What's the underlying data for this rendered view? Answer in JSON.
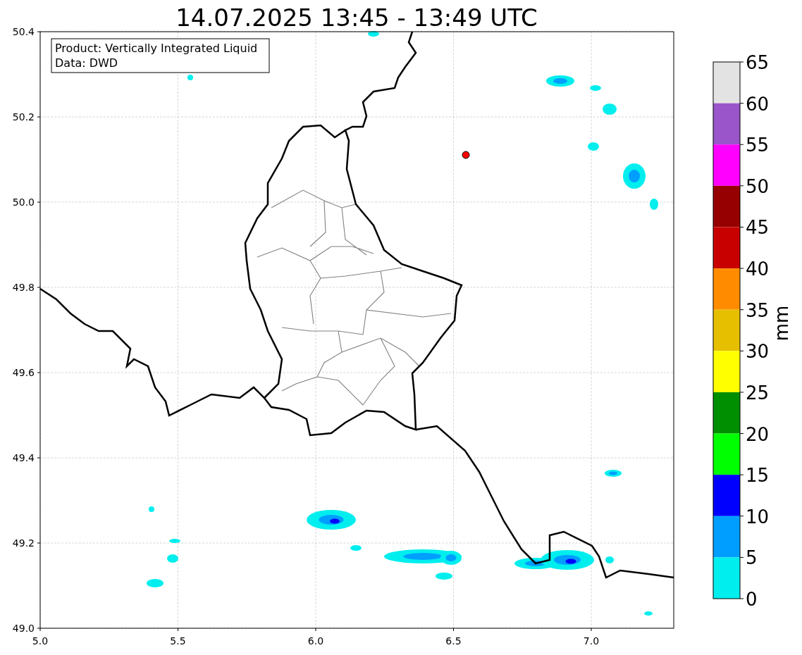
{
  "title": "14.07.2025 13:45 - 13:49 UTC",
  "legend": [
    "Product: Vertically Integrated Liquid",
    "Data: DWD"
  ],
  "xticks": [
    "5.0",
    "5.5",
    "6.0",
    "6.5",
    "7.0"
  ],
  "yticks": [
    "50.4",
    "50.2",
    "50.0",
    "49.8",
    "49.6",
    "49.4",
    "49.2",
    "49.0"
  ],
  "colorbar": {
    "label": "mm",
    "ticks": [
      "65",
      "60",
      "55",
      "50",
      "45",
      "40",
      "35",
      "30",
      "25",
      "20",
      "15",
      "10",
      "5",
      "0"
    ],
    "bins": [
      {
        "color": "#e3e3e3"
      },
      {
        "color": "#9955c9"
      },
      {
        "color": "#ff00ff"
      },
      {
        "color": "#960000"
      },
      {
        "color": "#c80000"
      },
      {
        "color": "#ff8c00"
      },
      {
        "color": "#e6c000"
      },
      {
        "color": "#ffff00"
      },
      {
        "color": "#008f00"
      },
      {
        "color": "#00ff00"
      },
      {
        "color": "#0000ff"
      },
      {
        "color": "#009eff"
      },
      {
        "color": "#00eeee"
      }
    ]
  }
}
